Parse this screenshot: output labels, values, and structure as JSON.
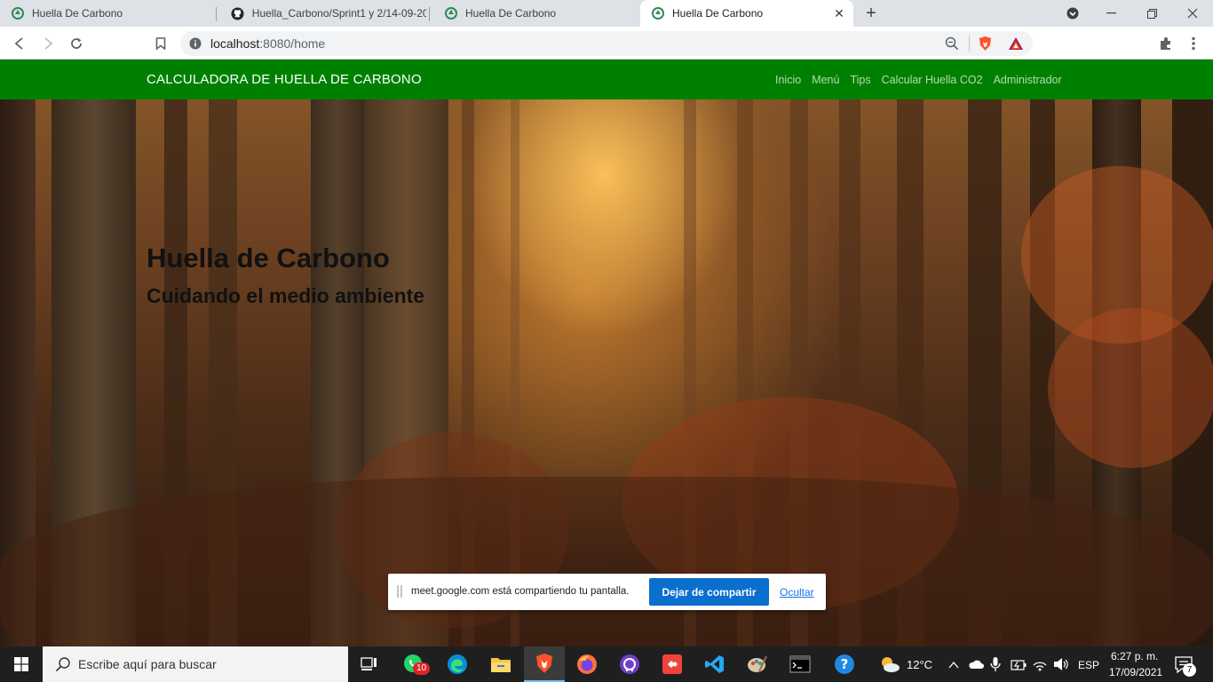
{
  "browser": {
    "tabs": [
      {
        "title": "Huella De Carbono",
        "icon": "recycle-icon"
      },
      {
        "title": "Huella_Carbono/Sprint1 y 2/14-09-20",
        "icon": "github-icon"
      },
      {
        "title": "Huella De Carbono",
        "icon": "recycle-icon"
      },
      {
        "title": "Huella De Carbono",
        "icon": "recycle-icon",
        "active": true
      }
    ],
    "url_host": "localhost",
    "url_path": ":8080/home"
  },
  "navbar": {
    "brand": "CALCULADORA DE HUELLA DE CARBONO",
    "links": [
      "Inicio",
      "Menú",
      "Tips",
      "Calcular Huella CO2",
      "Administrador"
    ],
    "bg_color": "#008000"
  },
  "hero": {
    "title": "Huella de Carbono",
    "subtitle": "Cuidando el medio ambiente"
  },
  "share_bar": {
    "message": "meet.google.com está compartiendo tu pantalla.",
    "stop_label": "Dejar de compartir",
    "hide_label": "Ocultar"
  },
  "taskbar": {
    "search_placeholder": "Escribe aquí para buscar",
    "whatsapp_badge": "10",
    "weather": "12°C",
    "language": "ESP",
    "time": "6:27 p. m.",
    "date": "17/09/2021",
    "notifications": "7"
  }
}
